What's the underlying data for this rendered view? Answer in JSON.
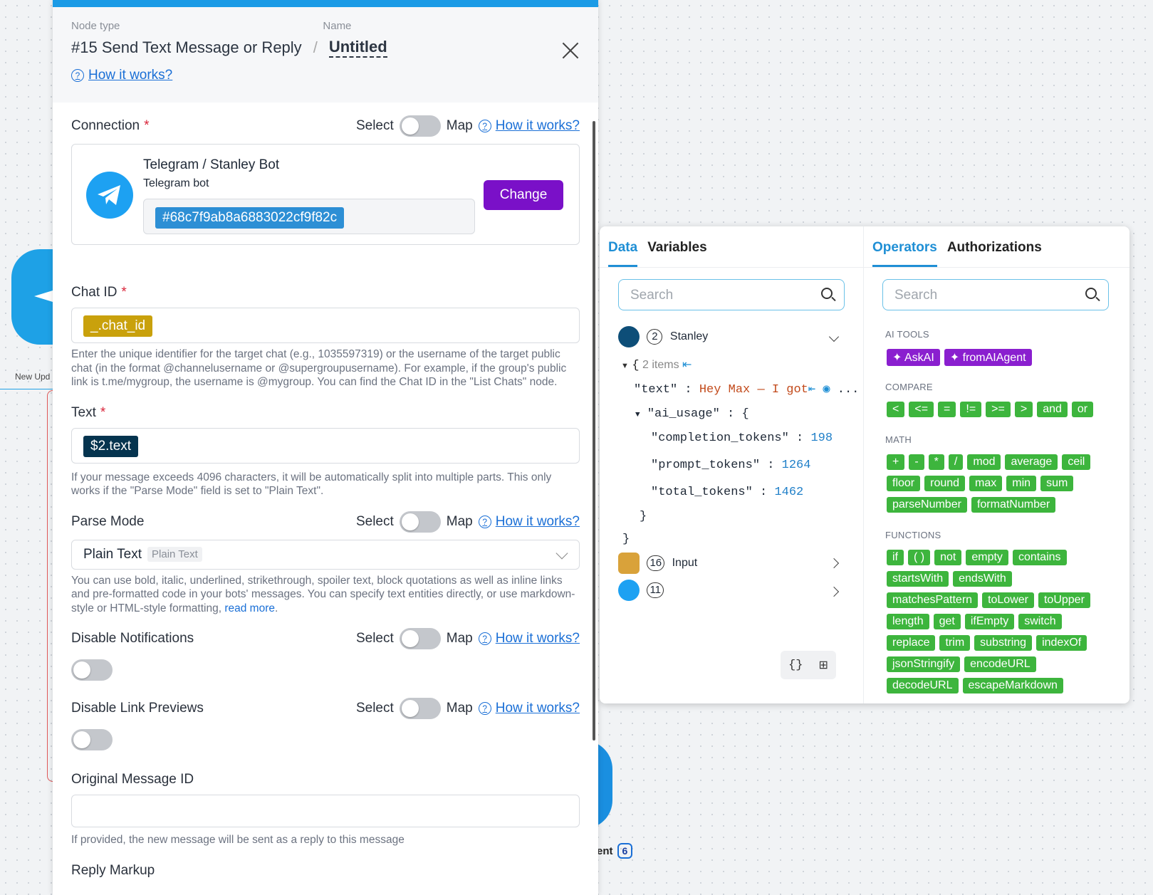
{
  "background": {
    "node_label": "New Upd",
    "ent_label": "ent",
    "ent_badge": "6"
  },
  "header": {
    "node_type_label": "Node type",
    "name_label": "Name",
    "node_title": "#15 Send Text Message or Reply",
    "name_value": "Untitled",
    "how_it_works": "How it works?"
  },
  "connection": {
    "label": "Connection",
    "required": "*",
    "select": "Select",
    "map": "Map",
    "how": "How it works?",
    "title": "Telegram / Stanley Bot",
    "subtitle": "Telegram bot",
    "id_value": "#68c7f9ab8a6883022cf9f82c",
    "change_label": "Change"
  },
  "chat_id": {
    "label": "Chat ID",
    "required": "*",
    "pill": "_.chat_id",
    "help": "Enter the unique identifier for the target chat (e.g., 1035597319) or the username of the target public chat (in the format @channelusername or @supergroupusername). For example, if the group's public link is t.me/mygroup, the username is @mygroup. You can find the Chat ID in the \"List Chats\" node."
  },
  "text_field": {
    "label": "Text",
    "required": "*",
    "pill": "$2.text",
    "help": "If your message exceeds 4096 characters, it will be automatically split into multiple parts. This only works if the \"Parse Mode\" field is set to \"Plain Text\"."
  },
  "parse_mode": {
    "label": "Parse Mode",
    "select": "Select",
    "map": "Map",
    "how": "How it works?",
    "value": "Plain Text",
    "tag": "Plain Text",
    "help": "You can use bold, italic, underlined, strikethrough, spoiler text, block quotations as well as inline links and pre-formatted code in your bots' messages. You can specify text entities directly, or use markdown-style or HTML-style formatting,",
    "read_more": "read more",
    "period": "."
  },
  "disable_notifications": {
    "label": "Disable Notifications",
    "select": "Select",
    "map": "Map",
    "how": "How it works?"
  },
  "disable_link_previews": {
    "label": "Disable Link Previews",
    "select": "Select",
    "map": "Map",
    "how": "How it works?"
  },
  "original_message": {
    "label": "Original Message ID",
    "help": "If provided, the new message will be sent as a reply to this message"
  },
  "reply_markup": {
    "label": "Reply Markup"
  },
  "data_panel": {
    "tab_data": "Data",
    "tab_variables": "Variables",
    "search_placeholder": "Search",
    "stanley_num": "2",
    "stanley_label": "Stanley",
    "items_count": "2 items",
    "text_key": "\"text\"",
    "colon": ":",
    "text_value": "Hey Max — I got",
    "ellipsis": "...",
    "ai_usage_key": "\"ai_usage\"",
    "open_brace": "{",
    "close_brace": "}",
    "completion_key": "\"completion_tokens\"",
    "completion_val": "198",
    "prompt_key": "\"prompt_tokens\"",
    "prompt_val": "1264",
    "total_key": "\"total_tokens\"",
    "total_val": "1462",
    "input_num": "16",
    "input_label": "Input",
    "tg_num": "11",
    "json_icon": "{}",
    "tree_icon": "tree-icon"
  },
  "ops_panel": {
    "tab_operators": "Operators",
    "tab_authorizations": "Authorizations",
    "search_placeholder": "Search",
    "ai_tools_label": "AI TOOLS",
    "ai_tools": [
      "AskAI",
      "fromAIAgent"
    ],
    "compare_label": "COMPARE",
    "compare": [
      "<",
      "<=",
      "=",
      "!=",
      ">=",
      ">",
      "and",
      "or"
    ],
    "math_label": "MATH",
    "math_row1": [
      "+",
      "-",
      "*",
      "/",
      "mod",
      "average",
      "ceil"
    ],
    "math_row2": [
      "floor",
      "round",
      "max",
      "min",
      "sum"
    ],
    "math_row3": [
      "parseNumber",
      "formatNumber"
    ],
    "functions_label": "FUNCTIONS",
    "fn_row1": [
      "if",
      "( )",
      "not",
      "empty",
      "contains"
    ],
    "fn_row2": [
      "startsWith",
      "endsWith"
    ],
    "fn_row3": [
      "matchesPattern",
      "toLower",
      "toUpper"
    ],
    "fn_row4": [
      "length",
      "get",
      "ifEmpty",
      "switch"
    ],
    "fn_row5": [
      "replace",
      "trim",
      "substring",
      "indexOf"
    ],
    "fn_row6": [
      "jsonStringify",
      "encodeURL"
    ],
    "fn_row7": [
      "decodeURL",
      "escapeMarkdown"
    ]
  },
  "colors": {
    "accent": "#1b9be6",
    "change_button": "#7a10c8",
    "operator_green": "#3db53d",
    "ai_purple": "#8a1fcf"
  }
}
